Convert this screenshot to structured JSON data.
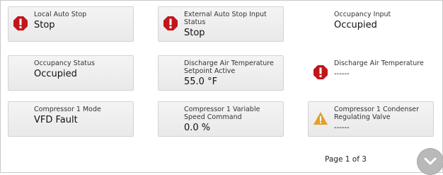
{
  "tiles": [
    {
      "label": "Local Auto Stop",
      "value": "Stop",
      "icon": "alarm-icon"
    },
    {
      "label": "External Auto Stop Input Status",
      "value": "Stop",
      "icon": "alarm-icon"
    },
    {
      "label": "Occupancy Input",
      "value": "Occupied",
      "icon": ""
    },
    {
      "label": "Occupancy Status",
      "value": "Occupied",
      "icon": ""
    },
    {
      "label": "Discharge Air Temperature Setpoint Active",
      "value": "55.0 °F",
      "icon": ""
    },
    {
      "label": "Discharge Air Temperature",
      "value": "------",
      "icon": "alarm-icon"
    },
    {
      "label": "Compressor 1 Mode",
      "value": "VFD Fault",
      "icon": ""
    },
    {
      "label": "Compressor 1 Variable Speed Command",
      "value": "0.0 %",
      "icon": ""
    },
    {
      "label": "Compressor 1 Condenser Regulating Valve",
      "value": "------",
      "icon": "warning-icon"
    }
  ],
  "pager": {
    "text": "Page 1 of 3"
  },
  "colors": {
    "alarm": "#c0171b",
    "warning": "#e3a127",
    "tile_bg": "#efefef",
    "tile_border": "#d3d3d3"
  }
}
